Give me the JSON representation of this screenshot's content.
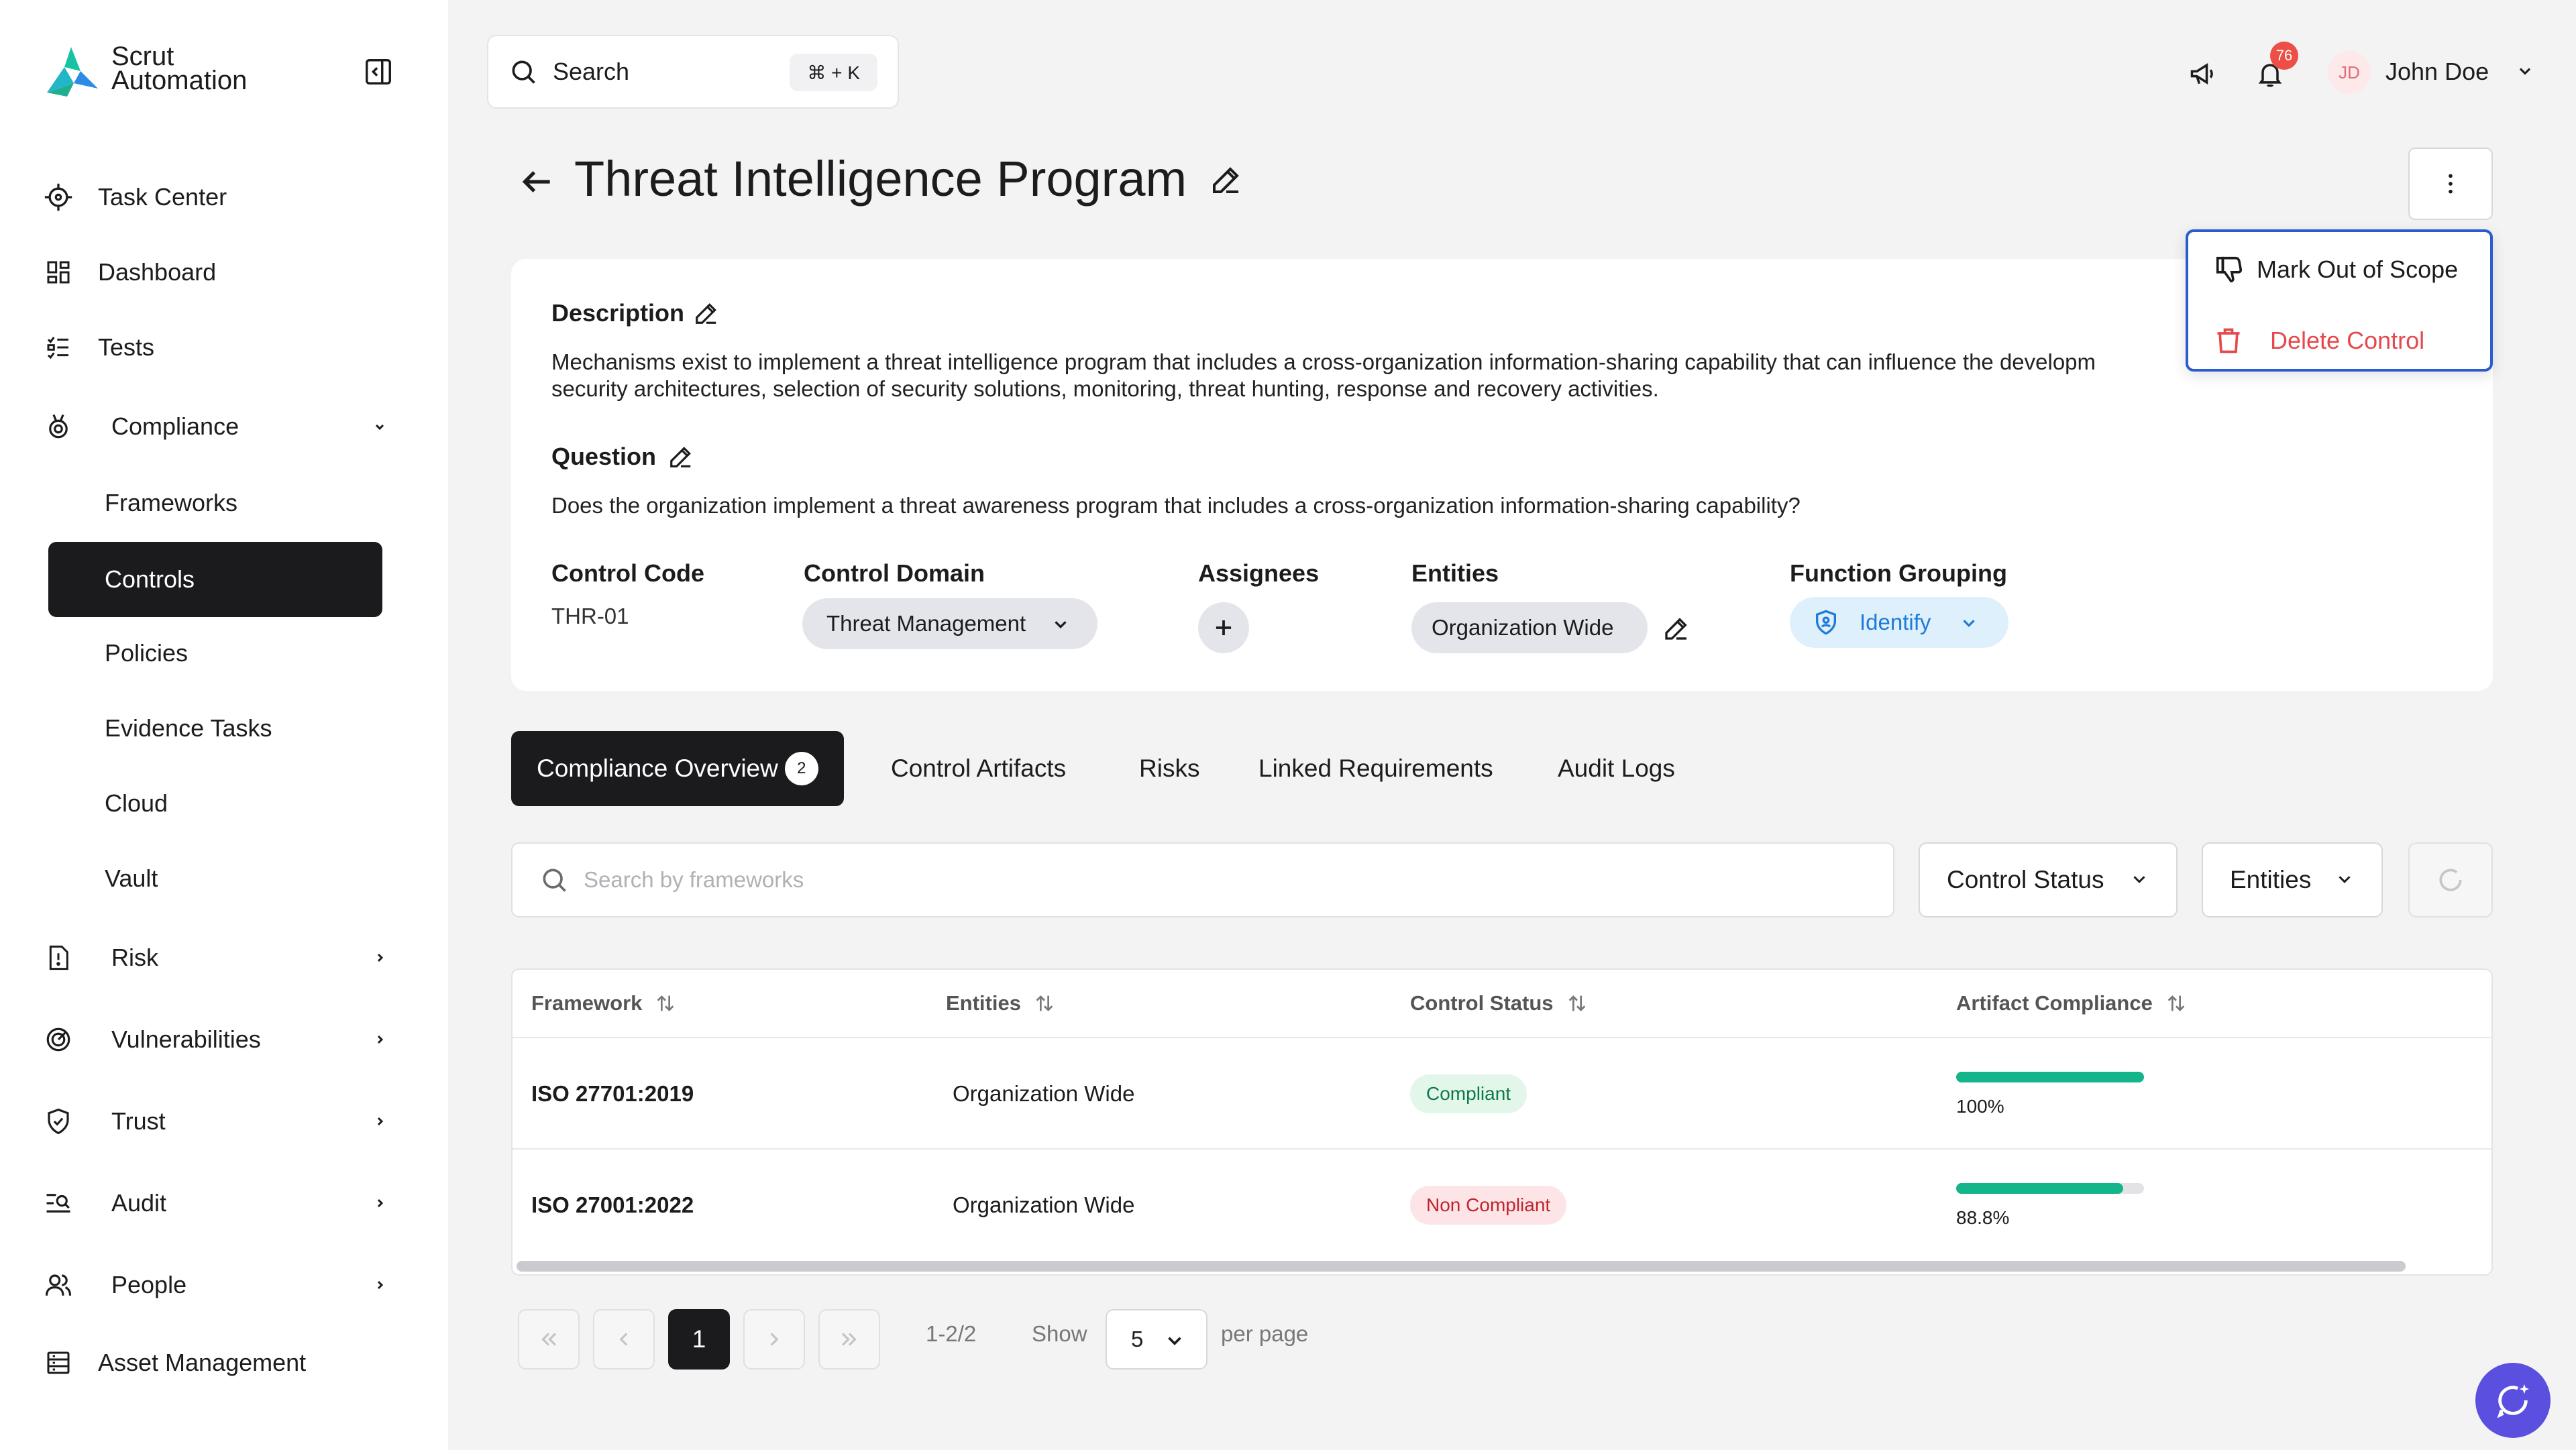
{
  "app": {
    "brand_line1": "Scrut",
    "brand_line2": "Automation",
    "brand_colors": [
      "#18c3a4",
      "#2d8ae6"
    ]
  },
  "sidebar": {
    "items": [
      {
        "label": "Task Center",
        "icon": "crosshair-icon"
      },
      {
        "label": "Dashboard",
        "icon": "dashboard-grid-icon"
      },
      {
        "label": "Tests",
        "icon": "checklist-icon"
      },
      {
        "label": "Compliance",
        "icon": "medal-icon",
        "expanded": true
      },
      {
        "label": "Risk",
        "icon": "risk-doc-icon"
      },
      {
        "label": "Vulnerabilities",
        "icon": "target-scan-icon"
      },
      {
        "label": "Trust",
        "icon": "shield-check-icon"
      },
      {
        "label": "Audit",
        "icon": "audit-search-icon"
      },
      {
        "label": "People",
        "icon": "people-icon"
      },
      {
        "label": "Asset Management",
        "icon": "asset-list-icon"
      }
    ],
    "compliance_sub": [
      {
        "label": "Frameworks"
      },
      {
        "label": "Controls",
        "active": true
      },
      {
        "label": "Policies"
      },
      {
        "label": "Evidence Tasks"
      },
      {
        "label": "Cloud"
      },
      {
        "label": "Vault"
      }
    ]
  },
  "topbar": {
    "search_label": "Search",
    "search_shortcut": "⌘ + K",
    "notification_count": "76",
    "user_initials": "JD",
    "user_name": "John Doe"
  },
  "page": {
    "title": "Threat Intelligence Program",
    "menu": {
      "mark_out_of_scope": "Mark Out of Scope",
      "delete_control": "Delete Control",
      "danger_color": "#e5484d"
    }
  },
  "details": {
    "description_label": "Description",
    "description_text": "Mechanisms exist to implement a threat intelligence program that includes a cross-organization information-sharing capability that can influence the developm",
    "description_text2": "security architectures, selection of security solutions, monitoring, threat hunting, response and recovery activities.",
    "question_label": "Question",
    "question_text": "Does the organization implement a threat awareness program that includes a cross-organization information-sharing capability?",
    "control_code_label": "Control Code",
    "control_code": "THR-01",
    "control_domain_label": "Control Domain",
    "control_domain": "Threat Management",
    "assignees_label": "Assignees",
    "entities_label": "Entities",
    "entities_value": "Organization Wide",
    "function_grouping_label": "Function Grouping",
    "function_grouping": "Identify"
  },
  "tabs": {
    "items": [
      {
        "label": "Compliance Overview",
        "count": "2",
        "active": true
      },
      {
        "label": "Control Artifacts"
      },
      {
        "label": "Risks"
      },
      {
        "label": "Linked Requirements"
      },
      {
        "label": "Audit Logs"
      }
    ]
  },
  "filters": {
    "search_placeholder": "Search by frameworks",
    "control_status": "Control Status",
    "entities": "Entities"
  },
  "table": {
    "columns": [
      "Framework",
      "Entities",
      "Control Status",
      "Artifact Compliance"
    ],
    "rows": [
      {
        "framework": "ISO 27701:2019",
        "entities": "Organization Wide",
        "status": "Compliant",
        "status_color": "#0f7a45",
        "status_bg": "#e3f6ea",
        "compliance": 1.0,
        "compliance_label": "100%"
      },
      {
        "framework": "ISO 27001:2022",
        "entities": "Organization Wide",
        "status": "Non Compliant",
        "status_color": "#c0232c",
        "status_bg": "#fde4e6",
        "compliance": 0.888,
        "compliance_label": "88.8%"
      }
    ]
  },
  "pagination": {
    "current_page": "1",
    "range": "1-2/2",
    "show_label": "Show",
    "per_page_value": "5",
    "per_page_label": "per page"
  }
}
